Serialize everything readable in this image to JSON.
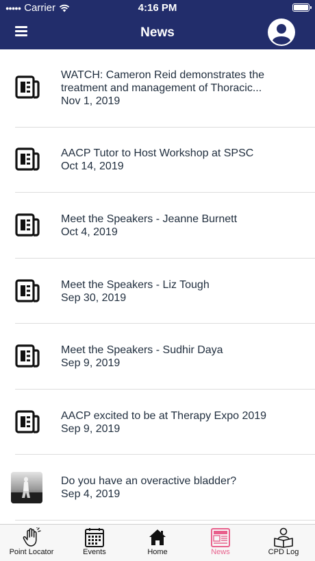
{
  "status_bar": {
    "carrier": "Carrier",
    "time": "4:16 PM"
  },
  "header": {
    "title": "News"
  },
  "news": [
    {
      "title": "WATCH: Cameron Reid demonstrates the treatment and management of Thoracic...",
      "date": "Nov 1, 2019",
      "icon": "newspaper-icon"
    },
    {
      "title": "AACP Tutor to Host Workshop at SPSC",
      "date": "Oct 14, 2019",
      "icon": "newspaper-icon"
    },
    {
      "title": "Meet the Speakers - Jeanne Burnett",
      "date": "Oct 4, 2019",
      "icon": "newspaper-icon"
    },
    {
      "title": "Meet the Speakers - Liz Tough",
      "date": "Sep 30, 2019",
      "icon": "newspaper-icon"
    },
    {
      "title": "Meet the Speakers - Sudhir Daya",
      "date": "Sep 9, 2019",
      "icon": "newspaper-icon"
    },
    {
      "title": "AACP excited to be at Therapy Expo 2019",
      "date": "Sep 9, 2019",
      "icon": "newspaper-icon"
    },
    {
      "title": "Do you have an overactive bladder?",
      "date": "Sep 4, 2019",
      "icon": "photo-thumbnail"
    }
  ],
  "tabs": [
    {
      "label": "Point Locator",
      "icon": "hand-icon"
    },
    {
      "label": "Events",
      "icon": "calendar-icon"
    },
    {
      "label": "Home",
      "icon": "home-icon"
    },
    {
      "label": "News",
      "icon": "newspaper-icon",
      "active": true
    },
    {
      "label": "CPD Log",
      "icon": "reader-icon"
    }
  ],
  "colors": {
    "header_bg": "#222d6b",
    "active_tab": "#e8608c",
    "text": "#1f2d3d"
  }
}
